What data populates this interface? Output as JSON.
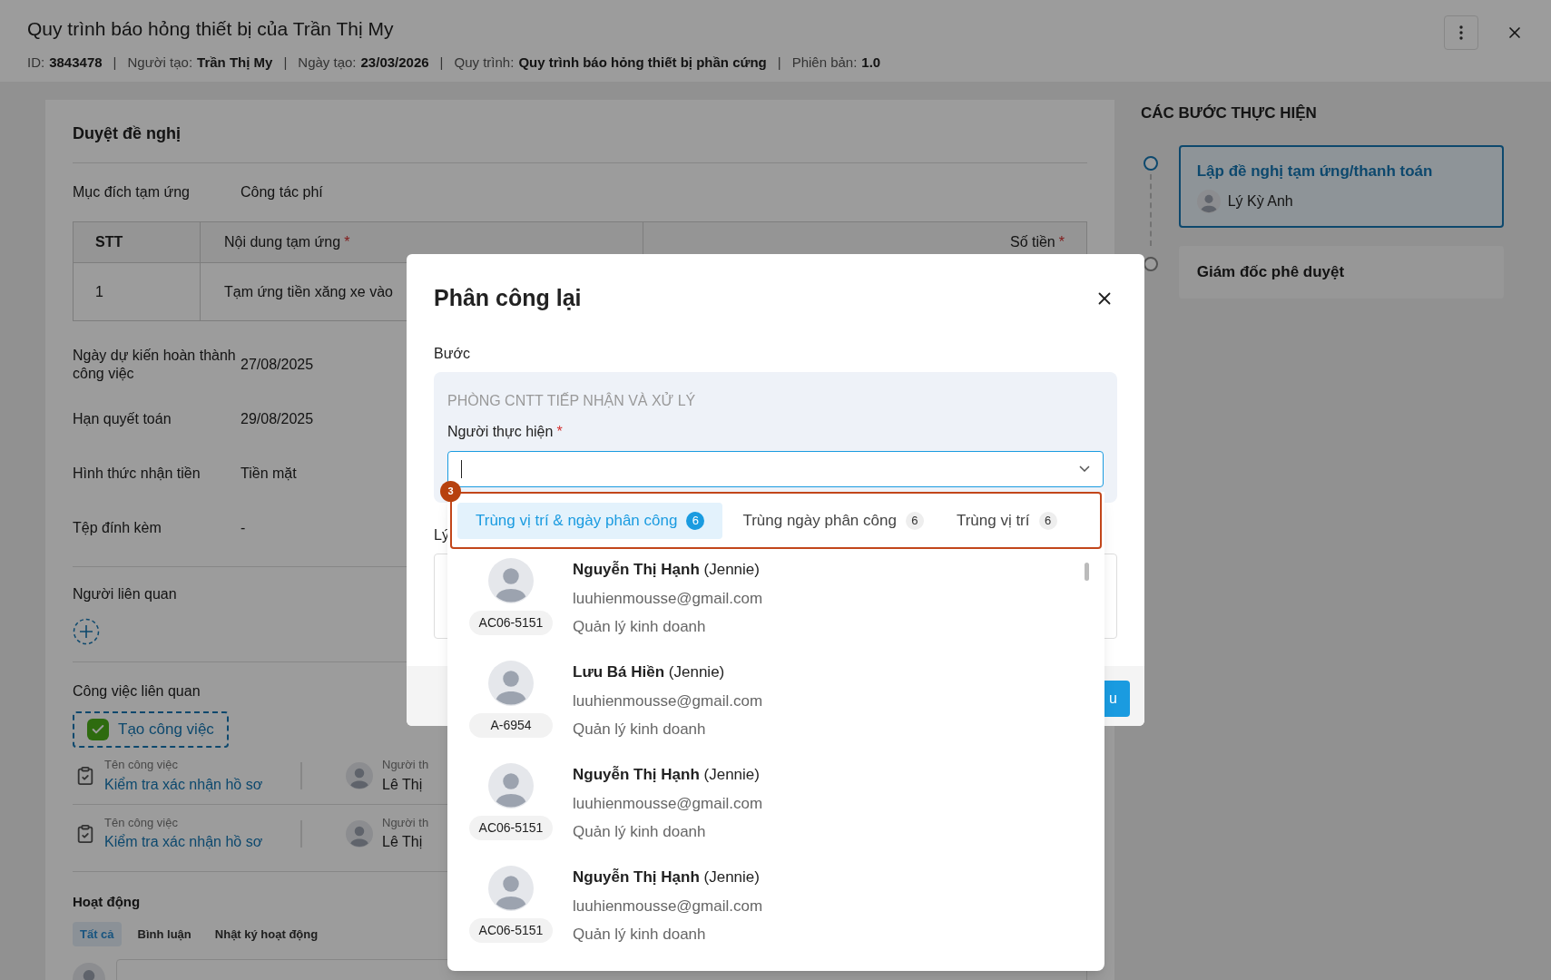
{
  "header": {
    "title": "Quy trình báo hỏng thiết bị của Trần Thị My",
    "separator": "|",
    "meta": [
      {
        "label": "ID:",
        "value": "3843478"
      },
      {
        "label": "Người tạo:",
        "value": "Trần Thị My"
      },
      {
        "label": "Ngày tạo:",
        "value": "23/03/2026"
      },
      {
        "label": "Quy trình:",
        "value": "Quy trình báo hỏng thiết bị phần cứng"
      },
      {
        "label": "Phiên bản:",
        "value": "1.0"
      }
    ]
  },
  "form": {
    "title": "Duyệt đề nghị",
    "purpose": {
      "label": "Mục đích tạm ứng",
      "value": "Công tác phí"
    },
    "table": {
      "columns": [
        {
          "label": "STT"
        },
        {
          "label": "Nội dung tạm ứng",
          "mark": "*"
        },
        {
          "label": "Số tiền",
          "mark": "*"
        }
      ],
      "rows": [
        {
          "cells": [
            "1",
            "Tạm ứng tiền xăng xe vào"
          ]
        }
      ]
    },
    "fields": [
      {
        "label": "Ngày dự kiến hoàn thành công việc",
        "value": "27/08/2025"
      },
      {
        "label": "Hạn quyết toán",
        "value": "29/08/2025"
      },
      {
        "label": "Hình thức nhận tiền",
        "value": "Tiền mặt"
      },
      {
        "label": "Tệp đính kèm",
        "value": "-"
      }
    ],
    "related_people": {
      "title": "Người liên quan"
    },
    "related_tasks": {
      "title": "Công việc liên quan",
      "create_button": "Tạo công việc",
      "tasks": [
        {
          "name_label": "Tên công việc",
          "name": "Kiểm tra xác nhận hồ sơ",
          "assignee_label": "Người th",
          "assignee": "Lê Thị"
        },
        {
          "name_label": "Tên công việc",
          "name": "Kiểm tra xác nhận hồ sơ",
          "assignee_label": "Người th",
          "assignee": "Lê Thị"
        }
      ]
    },
    "activity": {
      "title": "Hoạt động",
      "tabs": [
        {
          "label": "Tất cả",
          "selected": true
        },
        {
          "label": "Bình luận",
          "selected": false
        },
        {
          "label": "Nhật ký hoạt động",
          "selected": false
        }
      ]
    }
  },
  "steps": {
    "title": "CÁC BƯỚC THỰC HIỆN",
    "items": [
      {
        "title": "Lập đề nghị tạm ứng/thanh toán",
        "assignee": "Lý Kỳ Anh",
        "active": true
      },
      {
        "title": "Giám đốc phê duyệt",
        "active": false
      }
    ]
  },
  "dialog": {
    "title": "Phân công lại",
    "step_label": "Bước",
    "step_name": "PHÒNG CNTT TIẾP NHẬN VÀ XỬ LÝ",
    "assignee_label": "Người thực hiện",
    "assignee_mark": "*",
    "reason_label": "Lý",
    "footer_button": "u"
  },
  "picker": {
    "badge": "3",
    "tabs": [
      {
        "label": "Trùng vị trí & ngày phân công",
        "count": "6",
        "selected": true
      },
      {
        "label": "Trùng ngày phân công",
        "count": "6",
        "selected": false
      },
      {
        "label": "Trùng vị trí",
        "count": "6",
        "selected": false
      }
    ],
    "people": [
      {
        "name": "Nguyễn Thị Hạnh",
        "nickname": "(Jennie)",
        "email": "luuhienmousse@gmail.com",
        "role": "Quản lý kinh doanh",
        "code": "AC06-5151"
      },
      {
        "name": "Lưu Bá Hiền",
        "nickname": "(Jennie)",
        "email": "luuhienmousse@gmail.com",
        "role": "Quản lý kinh doanh",
        "code": "A-6954"
      },
      {
        "name": "Nguyễn Thị Hạnh",
        "nickname": "(Jennie)",
        "email": "luuhienmousse@gmail.com",
        "role": "Quản lý kinh doanh",
        "code": "AC06-5151"
      },
      {
        "name": "Nguyễn Thị Hạnh",
        "nickname": "(Jennie)",
        "email": "luuhienmousse@gmail.com",
        "role": "Quản lý kinh doanh",
        "code": "AC06-5151"
      }
    ]
  }
}
